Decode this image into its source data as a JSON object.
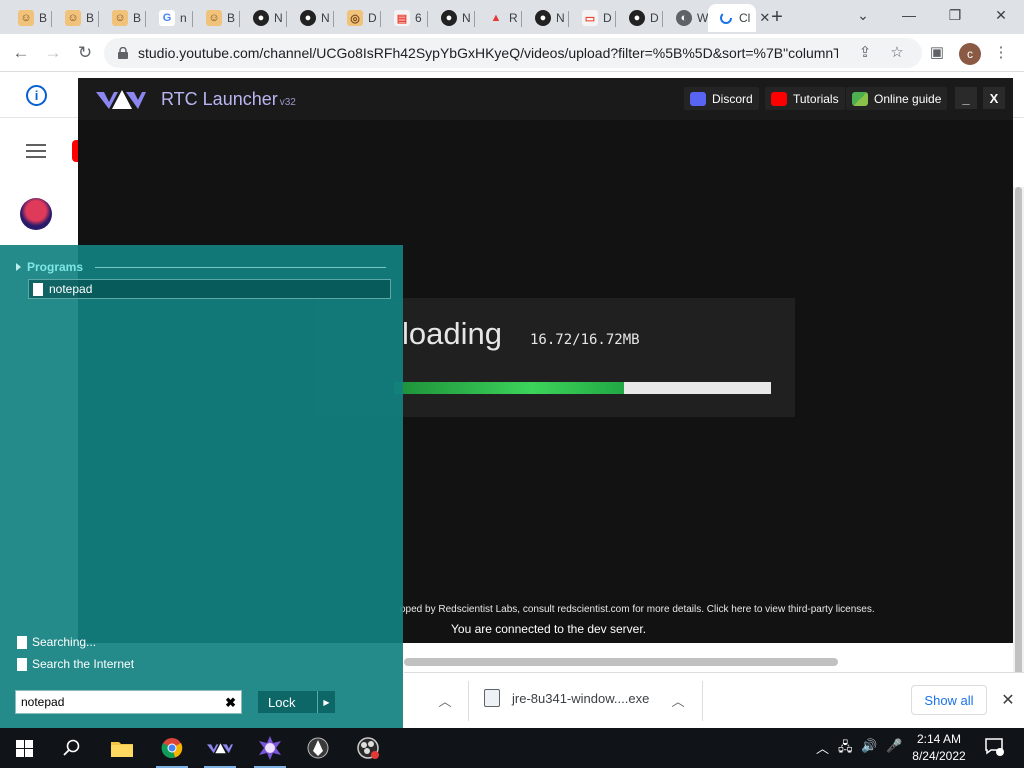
{
  "browser": {
    "tabs": [
      {
        "label": "B",
        "icon": "cat-icon"
      },
      {
        "label": "B",
        "icon": "cat-icon"
      },
      {
        "label": "B",
        "icon": "cat-icon"
      },
      {
        "label": "n",
        "icon": "google-icon"
      },
      {
        "label": "B",
        "icon": "cat-icon"
      },
      {
        "label": "N",
        "icon": "github-icon"
      },
      {
        "label": "N",
        "icon": "github-icon"
      },
      {
        "label": "D",
        "icon": "planet-icon"
      },
      {
        "label": "6",
        "icon": "document-icon"
      },
      {
        "label": "N",
        "icon": "github-icon"
      },
      {
        "label": "R",
        "icon": "warning-icon"
      },
      {
        "label": "N",
        "icon": "github-icon"
      },
      {
        "label": "D",
        "icon": "youtube-studio-icon"
      },
      {
        "label": "D",
        "icon": "github-icon"
      },
      {
        "label": "W",
        "icon": "globe-icon"
      }
    ],
    "active_tab": {
      "label": "Cl",
      "icon": "loading-icon"
    },
    "new_tab": "+",
    "url": "studio.youtube.com/channel/UCGo8IsRFh42SypYbGxHKyeQ/videos/upload?filter=%5B%5D&sort=%7B\"columnT...",
    "profile_initial": "c"
  },
  "launcher": {
    "title": "RTC Launcher",
    "version": "v32",
    "buttons": {
      "discord": "Discord",
      "tutorials": "Tutorials",
      "guide": "Online guide"
    },
    "minimize": "_",
    "close": "X",
    "loading_label": "loading",
    "size_text": "16.72/16.72MB",
    "progress": 0.61,
    "footer_credit": "oped by Redscientist Labs, consult redscientist.com for more details. Click here to view third-party licenses.",
    "footer_status": "You are connected to the dev server."
  },
  "start_menu": {
    "programs_header": "Programs",
    "result": "notepad",
    "searching": "Searching...",
    "search_internet": "Search the Internet",
    "search_value": "notepad",
    "lock_label": "Lock"
  },
  "downloads": {
    "file_name": "jre-8u341-window....exe",
    "show_all": "Show all"
  },
  "taskbar": {
    "time": "2:14 AM",
    "date": "8/24/2022"
  },
  "colors": {
    "launcher_accent": "#b8b6f2",
    "progress_green": "#3cd45a",
    "start_menu_teal": "#118080"
  }
}
